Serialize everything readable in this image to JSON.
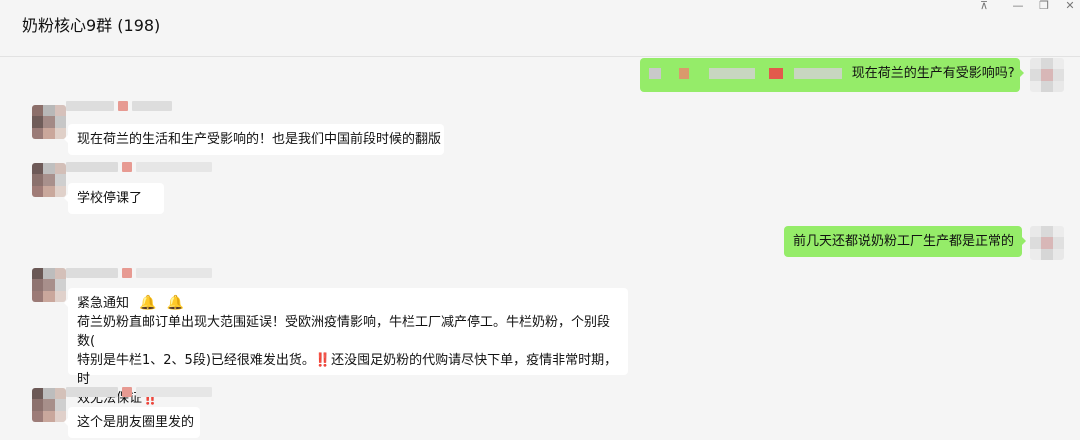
{
  "window": {
    "title": "奶粉核心9群 (198)",
    "controls": [
      "pin-icon",
      "minimize-icon",
      "maximize-icon",
      "close-icon"
    ]
  },
  "messages": [
    {
      "side": "self",
      "text": "现在荷兰的生产有受影响吗?"
    },
    {
      "side": "left",
      "text": "现在荷兰的生活和生产受影响的！也是我们中国前段时候的翻版"
    },
    {
      "side": "left",
      "text": "学校停课了"
    },
    {
      "side": "self",
      "text": "前几天还都说奶粉工厂生产都是正常的"
    },
    {
      "side": "left",
      "text_lines": [
        "紧急通知",
        "荷兰奶粉直邮订单出现大范围延误！受欧洲疫情影响，牛栏工厂减产停工。牛栏奶粉，个别段数(",
        "特别是牛栏1、2、5段)已经很难发出货。‼️还没囤足奶粉的代购请尽快下单，疫情非常时期，时",
        "效无法保证‼️"
      ]
    },
    {
      "side": "left",
      "text": "这个是朋友圈里发的"
    }
  ]
}
